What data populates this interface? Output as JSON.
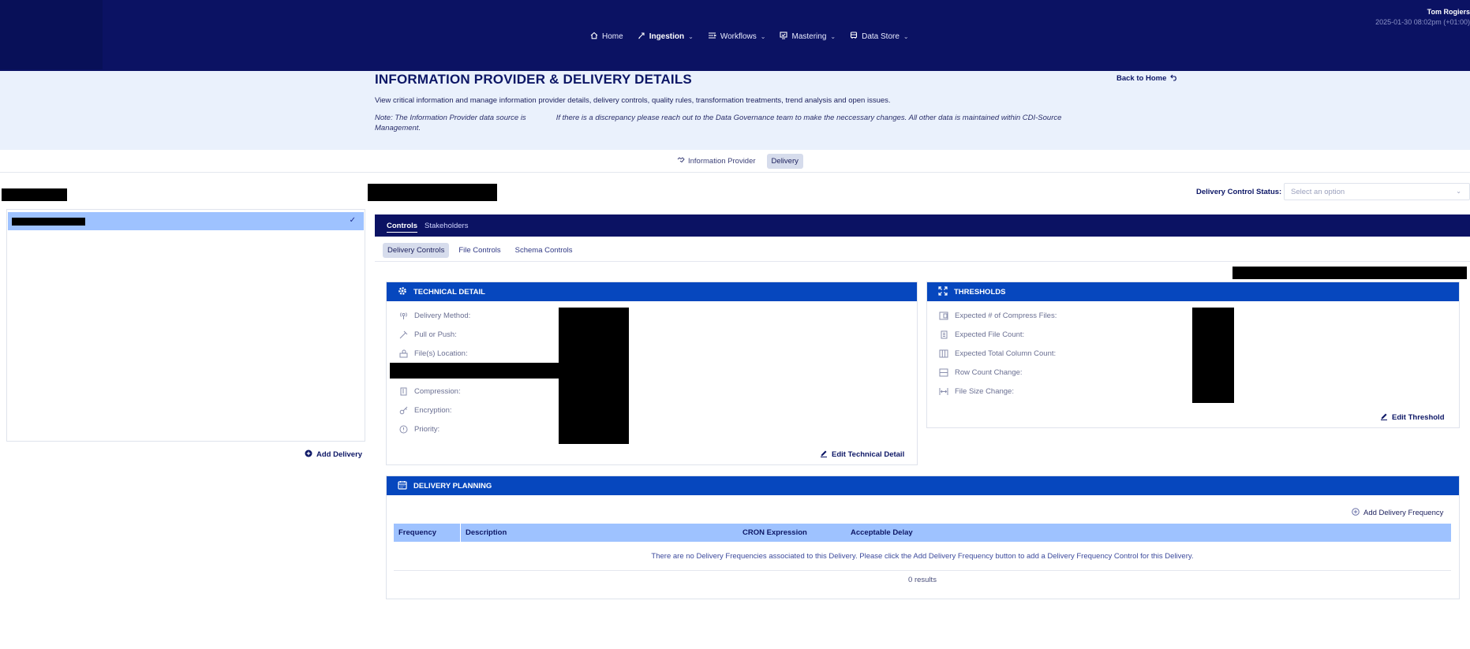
{
  "nav": {
    "items": [
      {
        "label": "Home",
        "icon": "home-icon",
        "has_dropdown": false
      },
      {
        "label": "Ingestion",
        "icon": "ingestion-icon",
        "has_dropdown": true,
        "active": true
      },
      {
        "label": "Workflows",
        "icon": "workflows-icon",
        "has_dropdown": true
      },
      {
        "label": "Mastering",
        "icon": "mastering-icon",
        "has_dropdown": true
      },
      {
        "label": "Data Store",
        "icon": "data-store-icon",
        "has_dropdown": true
      }
    ],
    "user_name": "Tom Rogiers",
    "timestamp": "2025-01-30 08:02pm (+01:00)"
  },
  "header": {
    "title": "INFORMATION PROVIDER & DELIVERY DETAILS",
    "description": "View critical information and manage information provider details, delivery controls, quality rules, transformation treatments, trend analysis and open issues.",
    "note_part1": "Note: The Information Provider data source is",
    "note_part2": "If there is a discrepancy please reach out to the Data Governance team to make the neccessary changes. All other data is maintained within CDI-Source Management.",
    "back_home": "Back to Home"
  },
  "section_tabs": [
    {
      "label": "Information Provider",
      "active": false
    },
    {
      "label": "Delivery",
      "active": true
    }
  ],
  "left": {
    "add_delivery": "Add Delivery"
  },
  "status": {
    "label": "Delivery Control Status:",
    "placeholder": "Select an option"
  },
  "control_tabs": [
    {
      "label": "Controls",
      "active": true
    },
    {
      "label": "Stakeholders",
      "active": false
    }
  ],
  "sub_tabs": [
    {
      "label": "Delivery Controls",
      "active": true
    },
    {
      "label": "File Controls",
      "active": false
    },
    {
      "label": "Schema Controls",
      "active": false
    }
  ],
  "technical": {
    "title": "TECHNICAL DETAIL",
    "fields": [
      "Delivery Method:",
      "Pull or Push:",
      "File(s) Location:",
      "Compression:",
      "Encryption:",
      "Priority:"
    ],
    "edit": "Edit Technical Detail"
  },
  "thresholds": {
    "title": "THRESHOLDS",
    "fields": [
      "Expected # of Compress Files:",
      "Expected File Count:",
      "Expected Total Column Count:",
      "Row Count Change:",
      "File Size Change:"
    ],
    "edit": "Edit Threshold"
  },
  "planning": {
    "title": "DELIVERY PLANNING",
    "add": "Add Delivery Frequency",
    "columns": [
      "Frequency",
      "Description",
      "CRON Expression",
      "Acceptable Delay"
    ],
    "empty": "There are no Delivery Frequencies associated to this Delivery. Please click the Add Delivery Frequency button to add a Delivery Frequency Control for this Delivery.",
    "results": "0 results"
  },
  "colors": {
    "nav_bg": "#0b1263",
    "header_band": "#eaf1fc",
    "card_header": "#0647be",
    "selection": "#9ec2ff"
  }
}
